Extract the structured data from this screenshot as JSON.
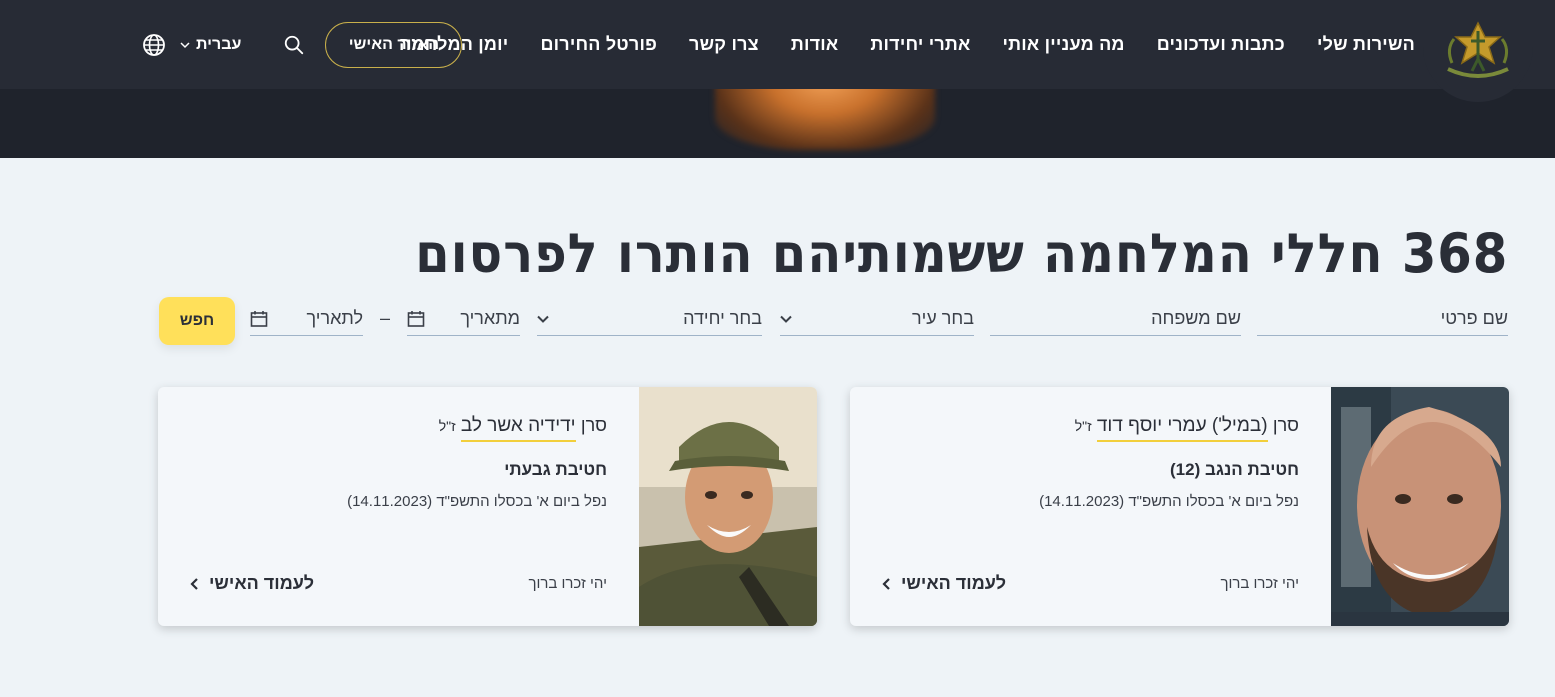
{
  "nav": {
    "links": [
      "השירות שלי",
      "כתבות ועדכונים",
      "מה מעניין אותי",
      "אתרי יחידות",
      "אודות",
      "צרו קשר",
      "פורטל החירום",
      "יומן המלחמה"
    ],
    "language": "עברית",
    "personal_area": "האזור האישי"
  },
  "page": {
    "title": "368 חללי המלחמה ששמותיהם הותרו לפרסום"
  },
  "filters": {
    "first_name": "שם פרטי",
    "last_name": "שם משפחה",
    "city": "בחר עיר",
    "unit": "בחר יחידה",
    "from_date": "מתאריך",
    "to_date": "לתאריך",
    "dash": "–",
    "submit": "חפש"
  },
  "cards": [
    {
      "rank": "סרן",
      "rank_note": "(במיל')",
      "name": "עמרי יוסף דוד",
      "suffix": "ז\"ל",
      "unit": "חטיבת הנגב (12)",
      "date": "נפל ביום א' בכסלו התשפ\"ד (14.11.2023)",
      "memory": "יהי זכרו ברוך",
      "link": "לעמוד האישי"
    },
    {
      "rank": "סרן",
      "rank_note": "",
      "name": "ידידיה אשר לב",
      "suffix": "ז\"ל",
      "unit": "חטיבת גבעתי",
      "date": "נפל ביום א' בכסלו התשפ\"ד (14.11.2023)",
      "memory": "יהי זכרו ברוך",
      "link": "לעמוד האישי"
    }
  ],
  "colors": {
    "header_bg": "#272b35",
    "accent_yellow": "#ffe05a",
    "page_bg": "#eef3f7",
    "gold_border": "#c9b04b"
  }
}
